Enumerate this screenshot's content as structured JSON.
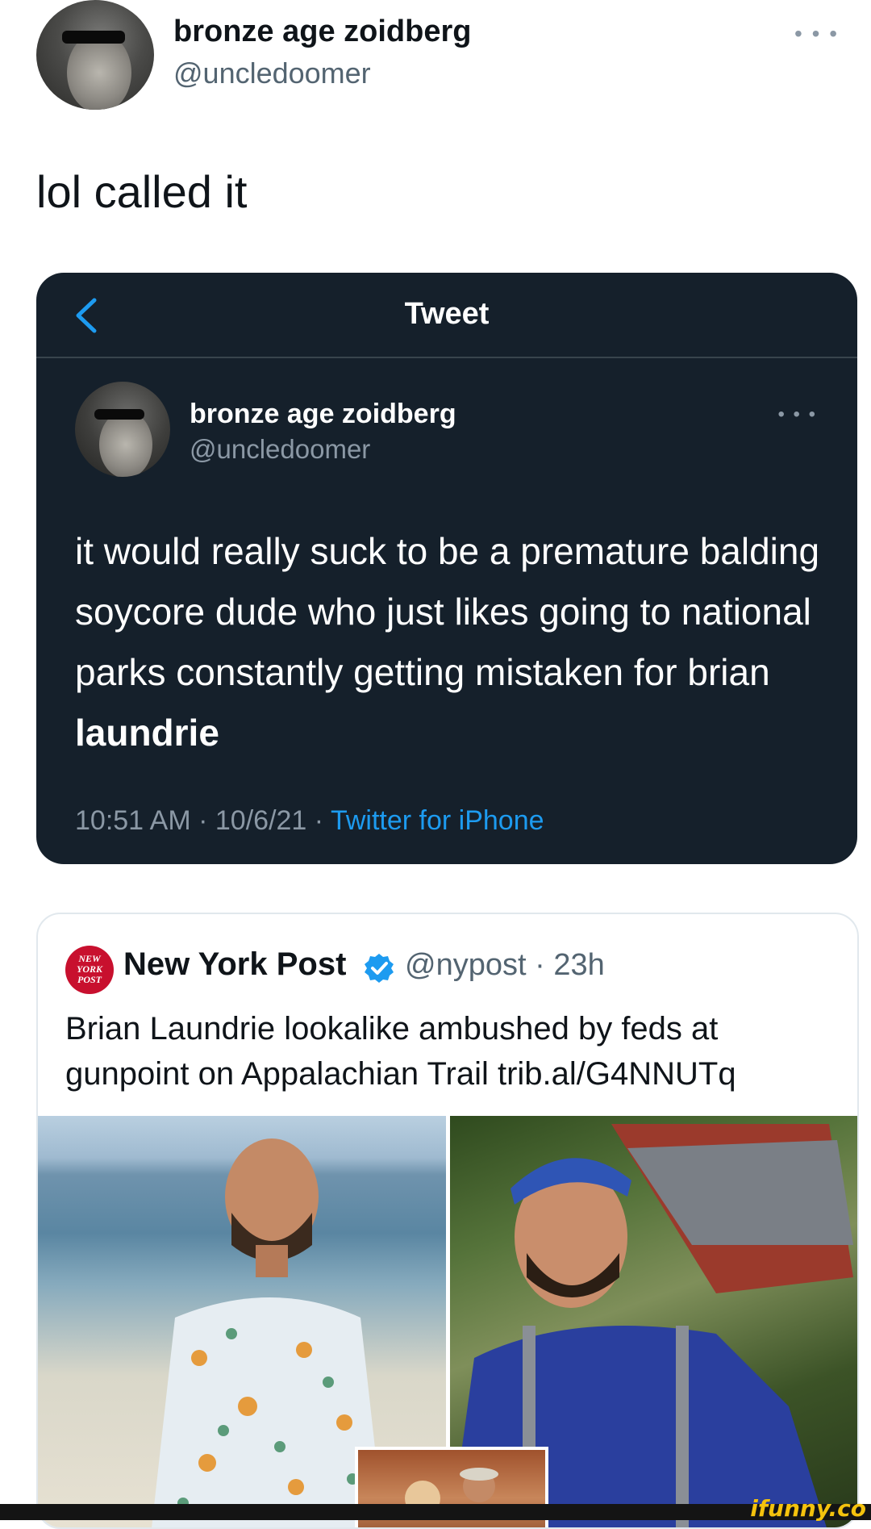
{
  "header": {
    "name": "bronze age zoidberg",
    "handle": "@uncledoomer",
    "more_icon": "ellipsis-icon"
  },
  "tweet": {
    "text": "lol called it"
  },
  "embedded_screenshot": {
    "title": "Tweet",
    "back_icon": "chevron-left-icon",
    "name": "bronze age zoidberg",
    "handle": "@uncledoomer",
    "more_icon": "ellipsis-icon",
    "body_plain": "it would really suck to be a premature balding soycore dude who just likes going to national parks constantly getting mistaken for brian",
    "body_bold": "laundrie",
    "time": "10:51 AM",
    "date": "10/6/21",
    "source": "Twitter for iPhone",
    "colors": {
      "background": "#15202b",
      "link": "#1d9bf0"
    }
  },
  "quoted": {
    "logo_text": "NEW YORK POST",
    "name": "New York Post",
    "verified_icon": "verified-badge-icon",
    "handle": "@nypost",
    "age": "23h",
    "text": "Brian Laundrie lookalike ambushed by feds at gunpoint on Appalachian Trail trib.al/G4NNUTq"
  },
  "watermark": "ifunny.co"
}
